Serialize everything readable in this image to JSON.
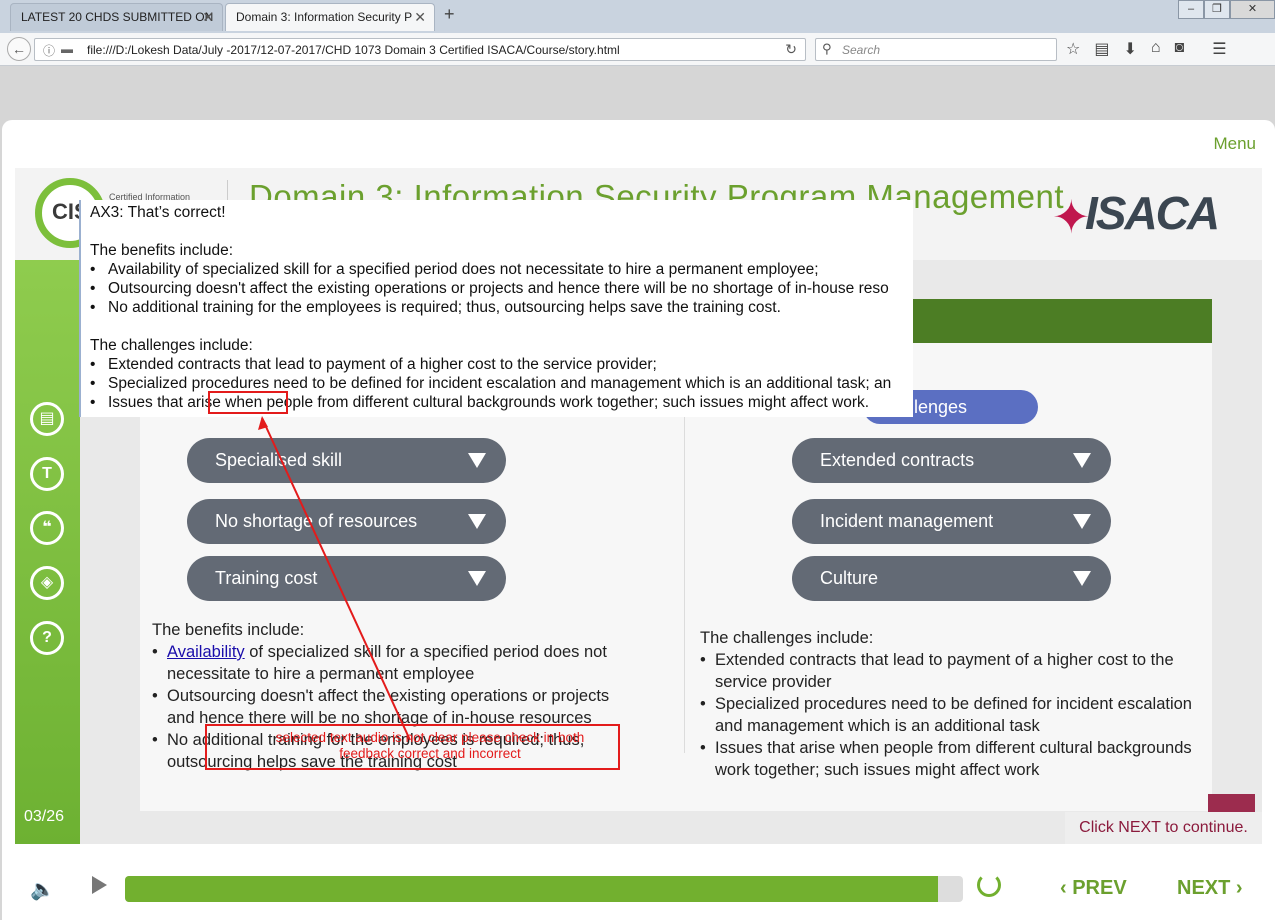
{
  "browser": {
    "tabs": [
      {
        "label": "LATEST 20 CHDS SUBMITTED ON"
      },
      {
        "label": "Domain 3: Information Security P"
      }
    ],
    "url": "file:///D:/Lokesh Data/July -2017/12-07-2017/CHD 1073 Domain 3 Certified ISACA/Course/story.html",
    "search_placeholder": "Search"
  },
  "player": {
    "menu_label": "Menu",
    "logo_text": "CIS",
    "logo_sub": "Certified Information",
    "domain_title": "Domain 3: Information Security Program Management",
    "brand": "ISACA",
    "slide_counter": "03/26",
    "progress_fraction": 0.97,
    "prev_label": "PREV",
    "next_label": "NEXT",
    "next_hint": "Click NEXT to continue."
  },
  "left_column": {
    "pills": [
      "Specialised skill",
      "No shortage of resources",
      "Training cost"
    ],
    "intro": "The benefits include:",
    "bullets": [
      {
        "link": "Availability",
        "text": " of specialized skill for a specified period does not necessitate to hire a permanent employee"
      },
      {
        "text": "Outsourcing doesn't affect the existing operations or projects and hence there will be no shortage of in-house resources"
      },
      {
        "text": "No additional training for the employees is required; thus, outsourcing helps save the training cost"
      }
    ]
  },
  "right_column": {
    "header_pill": "Challenges",
    "pills": [
      "Extended contracts",
      "Incident management",
      "Culture"
    ],
    "intro": "The challenges include:",
    "bullets": [
      "Extended contracts that lead to payment of a higher cost to the service provider",
      "Specialized procedures need to be defined for incident escalation and management which is an additional task",
      "Issues that arise when people from different cultural backgrounds work together; such issues might affect work"
    ]
  },
  "feedback": {
    "title": "AX3: That’s correct!",
    "benefits_intro": "The benefits include:",
    "benefits": [
      "Availability of specialized skill for a specified period does not necessitate to hire a permanent employee;",
      "Outsourcing doesn't affect the existing operations or projects and hence there will be no shortage of in-house reso",
      "No additional training for the employees is required; thus, outsourcing helps save the training cost."
    ],
    "challenges_intro": "The challenges include:",
    "challenges": [
      "Extended contracts that lead to payment of a higher cost to the service provider;",
      "Specialized procedures need to be defined for incident escalation and management which is an additional task; an",
      "Issues that arise when people from different cultural backgrounds work together; such issues might affect work."
    ]
  },
  "annotation": {
    "line1": "selected text audio is not clear please check in both",
    "line2": "feedback correct and incorrect",
    "color": "#e31b1b"
  },
  "colors": {
    "accent_green": "#6ba02e",
    "pill_gray": "#636a75",
    "challenge_blue": "#5b6fc2",
    "dark_green_bar": "#4c7d24",
    "hint_maroon": "#8b1a3c"
  }
}
